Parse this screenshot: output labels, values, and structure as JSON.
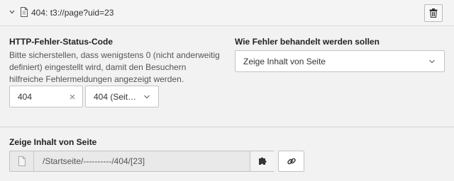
{
  "header": {
    "title": "404: t3://page?uid=23",
    "icons": {
      "collapse": "chevron-down-icon",
      "record": "document-icon",
      "delete": "trash-icon"
    }
  },
  "status_code": {
    "label": "HTTP-Fehler-Status-Code",
    "help_text": "Bitte sicherstellen, dass wenigstens 0 (nicht anderweitig definiert) eingestellt wird, damit den Besuchern hilfreiche Fehlermeldungen angezeigt werden.",
    "input_value": "404",
    "select_value": "404 (Seit…"
  },
  "handling": {
    "label": "Wie Fehler behandelt werden sollen",
    "select_value": "Zeige Inhalt von Seite"
  },
  "show_page": {
    "label": "Zeige Inhalt von Seite",
    "path": "/Startseite/----------/404/[23]"
  }
}
